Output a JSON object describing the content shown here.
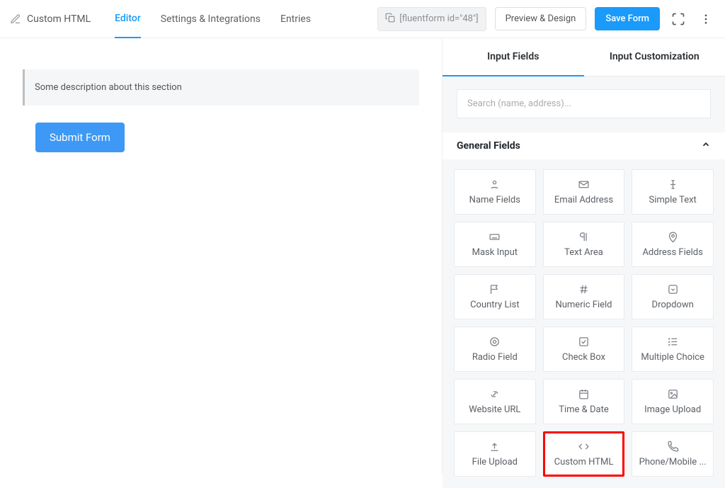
{
  "header": {
    "title": "Custom HTML",
    "tabs": [
      "Editor",
      "Settings & Integrations",
      "Entries"
    ],
    "active_tab": 0,
    "shortcode": "[fluentform id=\"48\"]",
    "preview_label": "Preview & Design",
    "save_label": "Save Form"
  },
  "canvas": {
    "section_description": "Some description about this section",
    "submit_label": "Submit Form"
  },
  "sidebar": {
    "tabs": [
      "Input Fields",
      "Input Customization"
    ],
    "active_tab": 0,
    "search_placeholder": "Search (name, address)..."
  },
  "field_group": {
    "title": "General Fields",
    "items": [
      {
        "label": "Name Fields",
        "icon": "user"
      },
      {
        "label": "Email Address",
        "icon": "mail"
      },
      {
        "label": "Simple Text",
        "icon": "textcursor"
      },
      {
        "label": "Mask Input",
        "icon": "keyboard"
      },
      {
        "label": "Text Area",
        "icon": "paragraph"
      },
      {
        "label": "Address Fields",
        "icon": "pin"
      },
      {
        "label": "Country List",
        "icon": "flag"
      },
      {
        "label": "Numeric Field",
        "icon": "hash"
      },
      {
        "label": "Dropdown",
        "icon": "chevboxdown"
      },
      {
        "label": "Radio Field",
        "icon": "target"
      },
      {
        "label": "Check Box",
        "icon": "check"
      },
      {
        "label": "Multiple Choice",
        "icon": "listcheck"
      },
      {
        "label": "Website URL",
        "icon": "link"
      },
      {
        "label": "Time & Date",
        "icon": "calendar"
      },
      {
        "label": "Image Upload",
        "icon": "image"
      },
      {
        "label": "File Upload",
        "icon": "upload"
      },
      {
        "label": "Custom HTML",
        "icon": "code",
        "highlight": true
      },
      {
        "label": "Phone/Mobile ...",
        "icon": "phone"
      }
    ]
  }
}
